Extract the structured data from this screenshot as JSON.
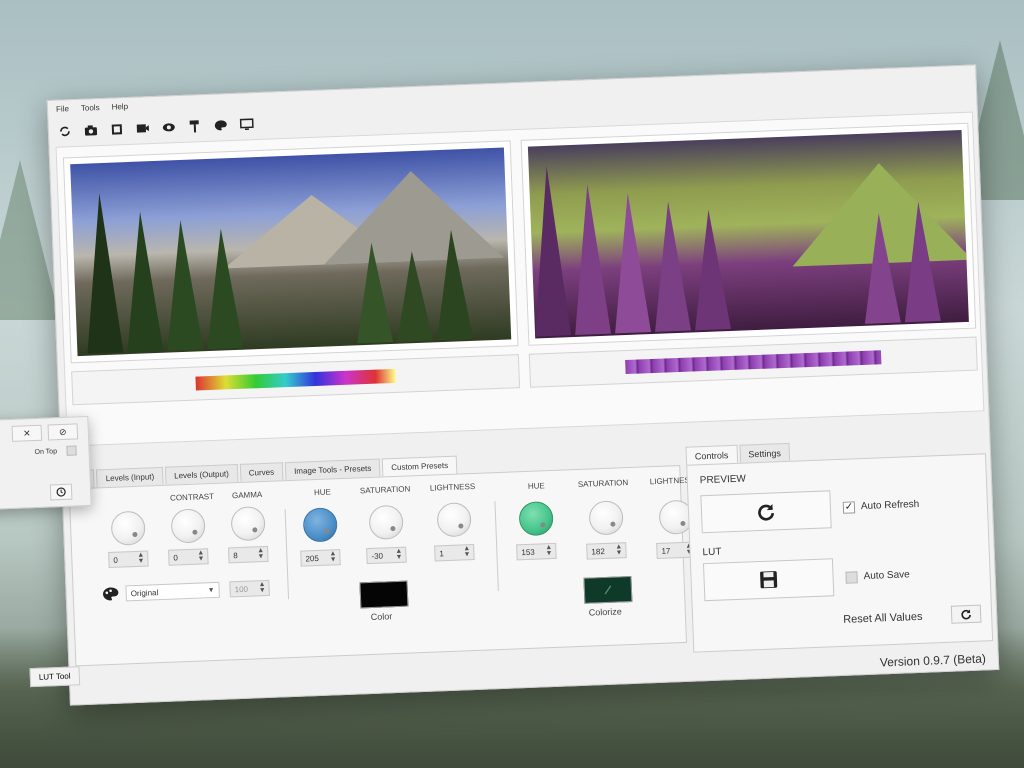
{
  "menu": [
    "File",
    "Tools",
    "Help"
  ],
  "toolbar_icons": [
    "refresh-icon",
    "camera-icon",
    "film-icon",
    "video-icon",
    "eye-icon",
    "paint-roller-icon",
    "palette-icon",
    "monitor-icon"
  ],
  "tabs_left": [
    "es",
    "Levels (Input)",
    "Levels (Output)",
    "Curves",
    "Image Tools - Presets",
    "Custom Presets"
  ],
  "levels": {
    "contrast_label": "CONTRAST",
    "gamma_label": "GAMMA",
    "v1": "0",
    "v2": "0",
    "v3": "8",
    "preset": "Original",
    "preset_amount": "100"
  },
  "color_group": {
    "hue_label": "HUE",
    "sat_label": "SATURATION",
    "light_label": "LIGHTNESS",
    "hue": "205",
    "saturation": "-30",
    "lightness": "1",
    "color_label": "Color",
    "color_swatch": "#050505"
  },
  "colorize_group": {
    "hue_label": "HUE",
    "sat_label": "SATURATION",
    "light_label": "LIGHTNESS",
    "hue": "153",
    "saturation": "182",
    "lightness": "17",
    "label": "Colorize",
    "swatch": "#0f3a2a"
  },
  "right_tabs": [
    "Controls",
    "Settings"
  ],
  "right_panel": {
    "preview_label": "PREVIEW",
    "auto_refresh_label": "Auto Refresh",
    "auto_refresh_checked": true,
    "lut_label": "LUT",
    "auto_save_label": "Auto Save",
    "auto_save_checked": false,
    "reset_label": "Reset All Values"
  },
  "floater": {
    "close": "✕",
    "disable": "⊘",
    "on_top": "On Top"
  },
  "bottom_tab": "LUT Tool",
  "version": "Version 0.9.7 (Beta)"
}
